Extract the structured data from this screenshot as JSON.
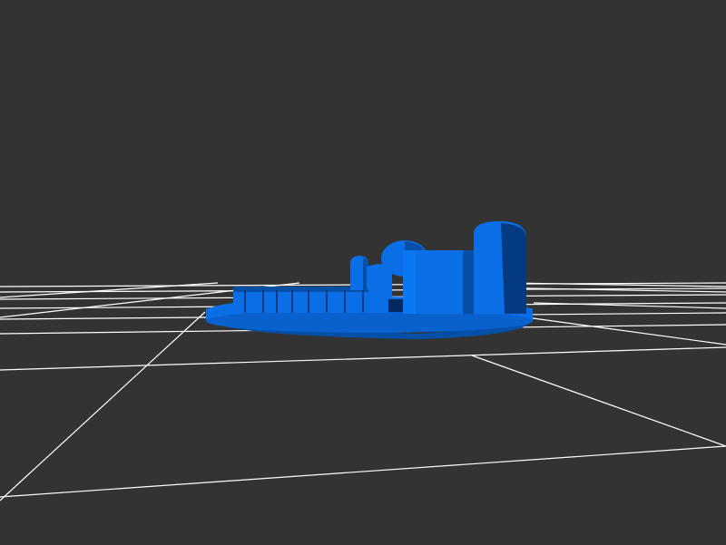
{
  "viewer": {
    "background_color": "#333333",
    "grid_color": "#ffffff",
    "model_color": "#0a6fe6",
    "model_shadow_color": "#064fa6",
    "model_dark_color": "#043a80"
  }
}
